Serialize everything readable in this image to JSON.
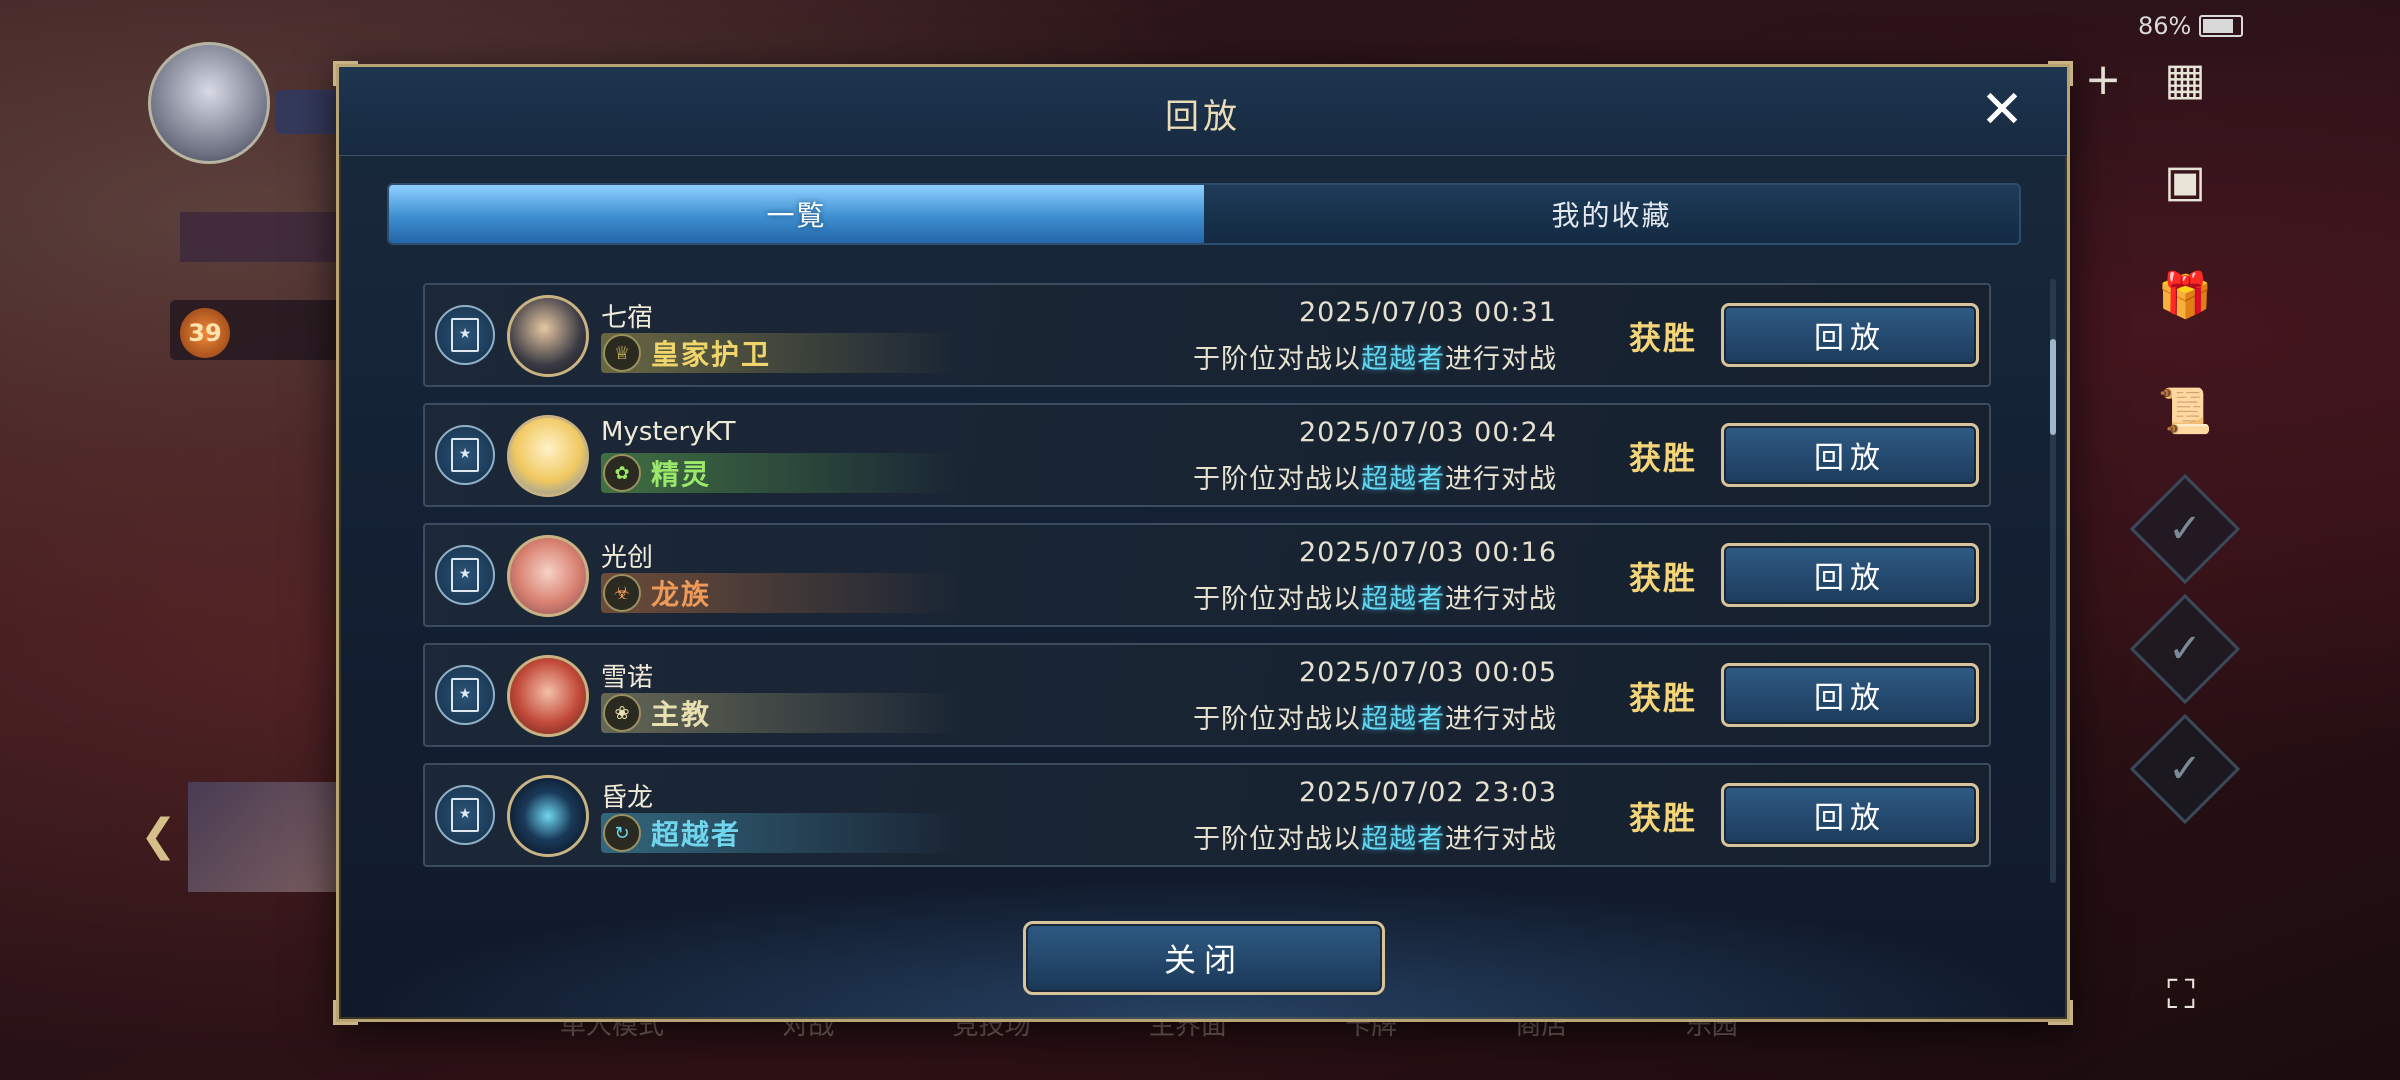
{
  "background": {
    "left_level": "39",
    "bottom_nav": [
      "单人模式",
      "对战",
      "竞技场",
      "主界面",
      "卡牌",
      "商店",
      "乐园"
    ],
    "status_bar": {
      "battery": "86%"
    }
  },
  "dialog": {
    "title": "回放",
    "tabs": [
      {
        "label": "一覧",
        "active": true
      },
      {
        "label": "我的收藏",
        "active": false
      }
    ],
    "entries": [
      {
        "name": "七宿",
        "class": "皇家护卫",
        "class_icon": "crown-icon",
        "class_color": "#f0d66a",
        "date": "2025/07/03  00:31",
        "desc_prefix": "于阶位对战以",
        "desc_highlight": "超越者",
        "desc_suffix": "进行对战",
        "result": "获胜",
        "button": "回放"
      },
      {
        "name": "MysteryKT",
        "class": "精灵",
        "class_icon": "leaf-icon",
        "class_color": "#9be86a",
        "date": "2025/07/03  00:24",
        "desc_prefix": "于阶位对战以",
        "desc_highlight": "超越者",
        "desc_suffix": "进行对战",
        "result": "获胜",
        "button": "回放"
      },
      {
        "name": "光创",
        "class": "龙族",
        "class_icon": "dragon-icon",
        "class_color": "#f09a5a",
        "date": "2025/07/03  00:16",
        "desc_prefix": "于阶位对战以",
        "desc_highlight": "超越者",
        "desc_suffix": "进行对战",
        "result": "获胜",
        "button": "回放"
      },
      {
        "name": "雪诺",
        "class": "主教",
        "class_icon": "wings-icon",
        "class_color": "#e8e0b0",
        "date": "2025/07/03  00:05",
        "desc_prefix": "于阶位对战以",
        "desc_highlight": "超越者",
        "desc_suffix": "进行对战",
        "result": "获胜",
        "button": "回放"
      },
      {
        "name": "昏龙",
        "class": "超越者",
        "class_icon": "spiral-icon",
        "class_color": "#6fd6ee",
        "date": "2025/07/02  23:03",
        "desc_prefix": "于阶位对战以",
        "desc_highlight": "超越者",
        "desc_suffix": "进行对战",
        "result": "获胜",
        "button": "回放"
      }
    ],
    "close_button": "关闭"
  }
}
